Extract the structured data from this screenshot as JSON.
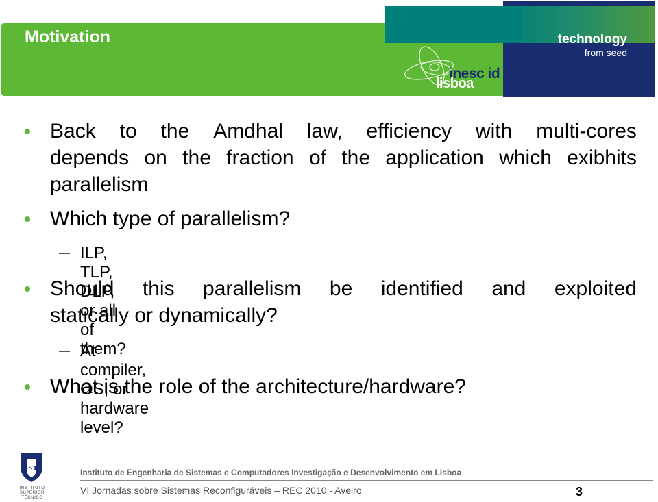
{
  "header": {
    "title": "Motivation",
    "tagline_main": "technology",
    "tagline_sub": "from seed",
    "logo": {
      "line1": "inesc id",
      "line2": "lisboa"
    },
    "colors": {
      "green": "#5db935",
      "teal": "#00807a",
      "navy": "#1a2d70"
    }
  },
  "bullets": [
    {
      "lines": [
        [
          "Back",
          "to",
          "the",
          "Amdhal",
          "law,",
          "efficiency",
          "with",
          "multi-cores"
        ],
        [
          "depends",
          "on",
          "the",
          "fraction",
          "of",
          "the",
          "application",
          "which",
          "exibhits"
        ]
      ],
      "last_line": "parallelism"
    },
    {
      "text": "Which type of parallelism?"
    },
    {
      "sub": "ILP, TLP, DLP, or all of them?"
    },
    {
      "lines": [
        [
          "Should",
          "this",
          "parallelism",
          "be",
          "identified",
          "and",
          "exploited"
        ]
      ],
      "last_line": "statically or dynamically?"
    },
    {
      "sub": "At compiler, OS,  or hardware level?"
    },
    {
      "text": "What is the role of the architecture/hardware?"
    }
  ],
  "footer": {
    "ist_logo_text": [
      "INSTITUTO",
      "SUPERIOR",
      "TÉCNICO"
    ],
    "institution": "Instituto de Engenharia de Sistemas e Computadores Investigação e Desenvolvimento em Lisboa",
    "event": "VI Jornadas sobre Sistemas Reconfiguráveis – REC 2010 - Aveiro",
    "page_number": "3"
  }
}
